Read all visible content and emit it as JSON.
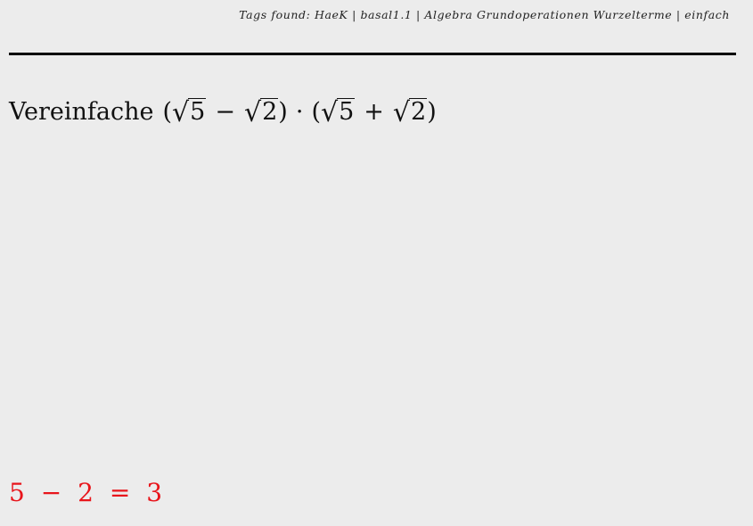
{
  "header": {
    "tags_text": "Tags found: HaeK | basal1.1 | Algebra Grundoperationen Wurzelterme | einfach"
  },
  "question": {
    "lead": "Vereinfache",
    "paren_open": "(",
    "paren_close": ")",
    "radicand_a": "5",
    "radicand_b": "2",
    "minus": "−",
    "plus": "+",
    "times": "·",
    "radical_sign": "√"
  },
  "answer": {
    "left": "5",
    "minus": "−",
    "right": "2",
    "equals": "=",
    "result": "3"
  },
  "colors": {
    "background": "#ececec",
    "answer": "#e8151b"
  }
}
